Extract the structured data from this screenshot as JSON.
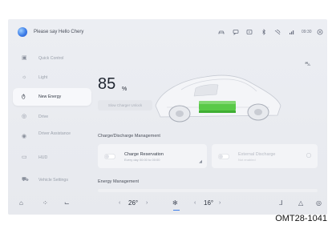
{
  "topbar": {
    "greeting": "Please say Hello Chery",
    "icons": [
      "car-icon",
      "chat-icon",
      "media-icon",
      "bluetooth-icon",
      "signal-icon",
      "cellular-icon"
    ],
    "time": "09:30"
  },
  "sidebar": {
    "items": [
      {
        "label": "Quick Control",
        "icon": "grid-icon",
        "active": false
      },
      {
        "label": "Light",
        "icon": "light-icon",
        "active": false
      },
      {
        "label": "New Energy",
        "icon": "plug-icon",
        "active": true
      },
      {
        "label": "Drive",
        "icon": "steering-wheel-icon",
        "active": false
      },
      {
        "label": "Driver Assistance",
        "icon": "driver-assist-icon",
        "active": false
      },
      {
        "label": "HUD",
        "icon": "hud-icon",
        "active": false
      },
      {
        "label": "Vehicle Settings",
        "icon": "vehicle-settings-icon",
        "active": false
      }
    ]
  },
  "main": {
    "battery_value": "85",
    "battery_unit": "%",
    "slow_charger_button": "Slow Charger Unlock",
    "charge_section_title": "Charge/Discharge Management",
    "charge_reservation": {
      "title": "Charge Reservation",
      "subtitle": "Every day 00:00 to 00:00"
    },
    "external_discharge": {
      "title": "External Discharge",
      "subtitle": "Not enabled"
    },
    "energy_section_title": "Energy Management"
  },
  "dock": {
    "left_temp": "26°",
    "right_temp": "16°",
    "icons": [
      "home-icon",
      "apps-icon",
      "seat-icon",
      "fan-icon",
      "seat-heat-icon",
      "warning-icon",
      "settings-icon"
    ]
  },
  "caption": "OMT28-1041",
  "colors": {
    "accent": "#3e7ee8",
    "battery_green": "#59c948",
    "background": "#eceef3"
  }
}
